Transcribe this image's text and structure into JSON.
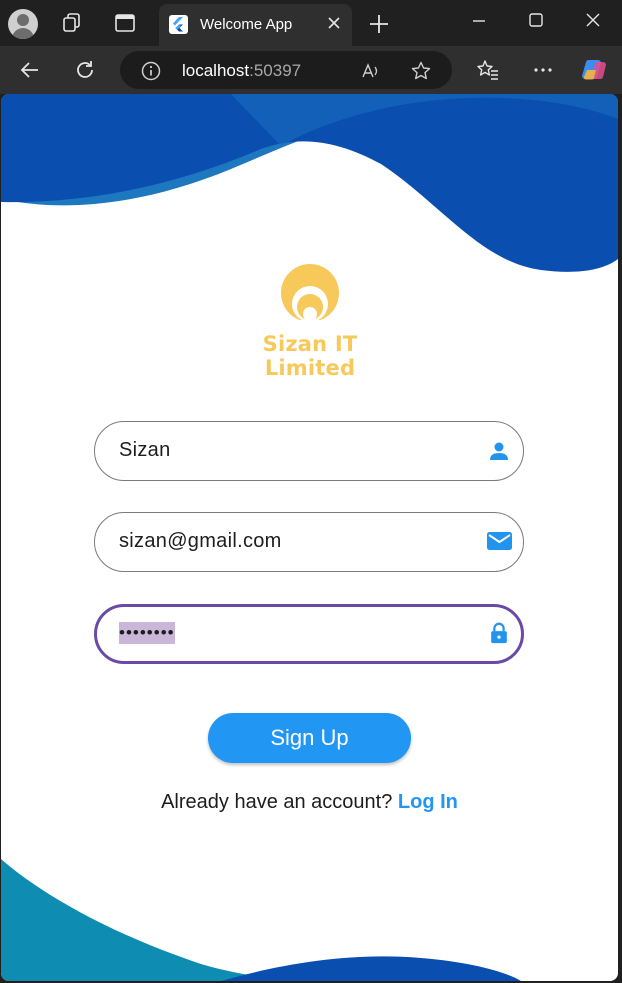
{
  "browser": {
    "tab_title": "Welcome App",
    "url_host": "localhost",
    "url_port": ":50397"
  },
  "page": {
    "brand_name": "Sizan IT Limited",
    "name_field": {
      "value": "Sizan",
      "icon": "person-icon"
    },
    "email_field": {
      "value": "sizan@gmail.com",
      "icon": "mail-icon"
    },
    "password_field": {
      "value": "••••••••",
      "icon": "lock-icon",
      "focused": true
    },
    "signup_label": "Sign Up",
    "login_prompt": "Already have an account?",
    "login_link": "Log In"
  },
  "colors": {
    "primary": "#2196f3",
    "focus_border": "#6a4aa5",
    "wave_dark": "#0a4fb0",
    "wave_teal": "#0e8cb2",
    "logo_gold": "#f7c85a"
  }
}
